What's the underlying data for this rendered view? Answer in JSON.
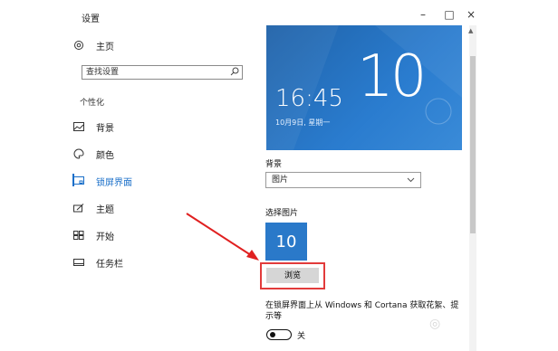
{
  "window": {
    "title": "设置",
    "controls": {
      "minimize": "–",
      "maximize": "□",
      "close": "×"
    }
  },
  "sidebar": {
    "home_label": "主页",
    "search_placeholder": "查找设置",
    "section_title": "个性化",
    "items": [
      {
        "label": "背景",
        "icon": "image-icon",
        "active": false
      },
      {
        "label": "颜色",
        "icon": "palette-icon",
        "active": false
      },
      {
        "label": "锁屏界面",
        "icon": "lockscreen-icon",
        "active": true
      },
      {
        "label": "主题",
        "icon": "brush-icon",
        "active": false
      },
      {
        "label": "开始",
        "icon": "start-icon",
        "active": false
      },
      {
        "label": "任务栏",
        "icon": "taskbar-icon",
        "active": false
      }
    ]
  },
  "main": {
    "preview": {
      "time": "16:45",
      "date": "10月9日, 星期一",
      "big_text": "10"
    },
    "background_label": "背景",
    "background_value": "图片",
    "choose_picture_label": "选择图片",
    "thumbnail_text": "10",
    "browse_label": "浏览",
    "option_text": "在锁屏界面上从 Windows 和 Cortana 获取花絮、提示等",
    "toggle_label": "关",
    "toggle_on": false
  },
  "colors": {
    "accent": "#1a6fc9",
    "highlight_frame": "#e23b3b",
    "preview_blue": "#2a79c9"
  }
}
